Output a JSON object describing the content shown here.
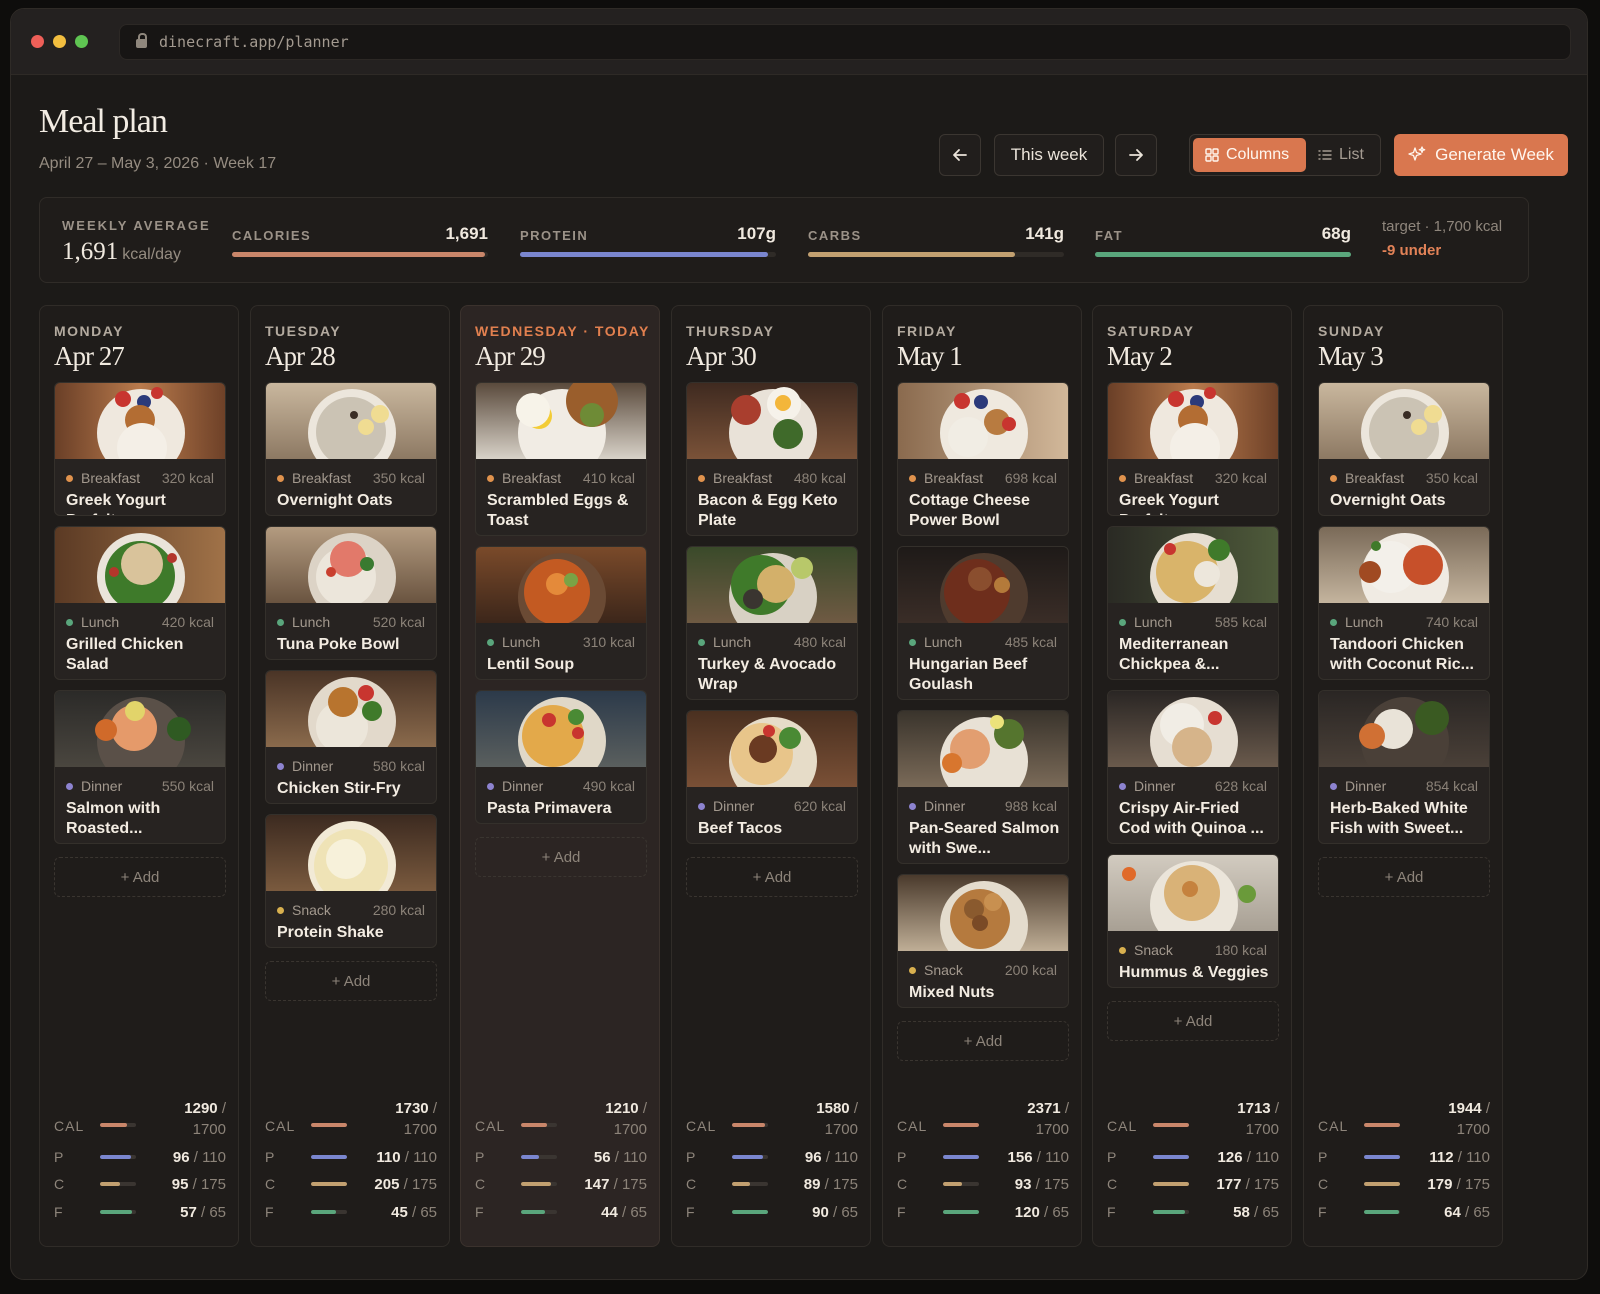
{
  "browser": {
    "url": "dinecraft.app/planner"
  },
  "header": {
    "title": "Meal plan",
    "subtitle": "April 27 – May 3, 2026 · Week 17",
    "prev_icon": "arrow-left-icon",
    "this_week_label": "This week",
    "next_icon": "arrow-right-icon",
    "view_columns_label": "Columns",
    "view_list_label": "List",
    "generate_label": "Generate Week"
  },
  "summary": {
    "label": "WEEKLY AVERAGE",
    "avg_value": "1,691",
    "avg_unit": "kcal/day",
    "macros": [
      {
        "label": "CALORIES",
        "value": "1,691",
        "progress": 0.99,
        "color": "#c9866a"
      },
      {
        "label": "PROTEIN",
        "value": "107g",
        "progress": 0.97,
        "color": "#7a86cf"
      },
      {
        "label": "CARBS",
        "value": "141g",
        "progress": 0.81,
        "color": "#c2a070"
      },
      {
        "label": "FAT",
        "value": "68g",
        "progress": 1.0,
        "color": "#5aa67c"
      }
    ],
    "target": "target · 1,700 kcal",
    "delta": "-9 under"
  },
  "meal_colors": {
    "Breakfast": "#e0924d",
    "Lunch": "#5aa67c",
    "Dinner": "#8d83d0",
    "Snack": "#d8b04f"
  },
  "bar_colors": {
    "cal": "#c9866a",
    "p": "#7a86cf",
    "c": "#c2a070",
    "f": "#5aa67c"
  },
  "add_label": "+ Add",
  "totals_labels": {
    "cal": "CAL",
    "p": "P",
    "c": "C",
    "f": "F"
  },
  "days": [
    {
      "name": "MONDAY",
      "date": "Apr 27",
      "meals": [
        {
          "type": "Breakfast",
          "kcal": "320 kcal",
          "name": "Greek Yogurt Parfait"
        },
        {
          "type": "Lunch",
          "kcal": "420 kcal",
          "name": "Grilled Chicken Salad"
        },
        {
          "type": "Dinner",
          "kcal": "550 kcal",
          "name": "Salmon with Roasted..."
        }
      ],
      "totals": {
        "cal": "1290",
        "cal_t": "1700",
        "p": "96",
        "p_t": "110",
        "c": "95",
        "c_t": "175",
        "f": "57",
        "f_t": "65"
      }
    },
    {
      "name": "TUESDAY",
      "date": "Apr 28",
      "meals": [
        {
          "type": "Breakfast",
          "kcal": "350 kcal",
          "name": "Overnight Oats"
        },
        {
          "type": "Lunch",
          "kcal": "520 kcal",
          "name": "Tuna Poke Bowl"
        },
        {
          "type": "Dinner",
          "kcal": "580 kcal",
          "name": "Chicken Stir-Fry"
        },
        {
          "type": "Snack",
          "kcal": "280 kcal",
          "name": "Protein Shake"
        }
      ],
      "totals": {
        "cal": "1730",
        "cal_t": "1700",
        "p": "110",
        "p_t": "110",
        "c": "205",
        "c_t": "175",
        "f": "45",
        "f_t": "65"
      }
    },
    {
      "name": "WEDNESDAY · TODAY",
      "date": "Apr 29",
      "today": true,
      "meals": [
        {
          "type": "Breakfast",
          "kcal": "410 kcal",
          "name": "Scrambled Eggs & Toast"
        },
        {
          "type": "Lunch",
          "kcal": "310 kcal",
          "name": "Lentil Soup"
        },
        {
          "type": "Dinner",
          "kcal": "490 kcal",
          "name": "Pasta Primavera"
        }
      ],
      "totals": {
        "cal": "1210",
        "cal_t": "1700",
        "p": "56",
        "p_t": "110",
        "c": "147",
        "c_t": "175",
        "f": "44",
        "f_t": "65"
      }
    },
    {
      "name": "THURSDAY",
      "date": "Apr 30",
      "meals": [
        {
          "type": "Breakfast",
          "kcal": "480 kcal",
          "name": "Bacon & Egg Keto Plate"
        },
        {
          "type": "Lunch",
          "kcal": "480 kcal",
          "name": "Turkey & Avocado Wrap"
        },
        {
          "type": "Dinner",
          "kcal": "620 kcal",
          "name": "Beef Tacos"
        }
      ],
      "totals": {
        "cal": "1580",
        "cal_t": "1700",
        "p": "96",
        "p_t": "110",
        "c": "89",
        "c_t": "175",
        "f": "90",
        "f_t": "65"
      }
    },
    {
      "name": "FRIDAY",
      "date": "May 1",
      "meals": [
        {
          "type": "Breakfast",
          "kcal": "698 kcal",
          "name": "Cottage Cheese Power Bowl"
        },
        {
          "type": "Lunch",
          "kcal": "485 kcal",
          "name": "Hungarian Beef Goulash"
        },
        {
          "type": "Dinner",
          "kcal": "988 kcal",
          "name": "Pan-Seared Salmon with Swe..."
        },
        {
          "type": "Snack",
          "kcal": "200 kcal",
          "name": "Mixed Nuts"
        }
      ],
      "totals": {
        "cal": "2371",
        "cal_t": "1700",
        "p": "156",
        "p_t": "110",
        "c": "93",
        "c_t": "175",
        "f": "120",
        "f_t": "65"
      }
    },
    {
      "name": "SATURDAY",
      "date": "May 2",
      "meals": [
        {
          "type": "Breakfast",
          "kcal": "320 kcal",
          "name": "Greek Yogurt Parfait"
        },
        {
          "type": "Lunch",
          "kcal": "585 kcal",
          "name": "Mediterranean Chickpea &..."
        },
        {
          "type": "Dinner",
          "kcal": "628 kcal",
          "name": "Crispy Air-Fried Cod with Quinoa ..."
        },
        {
          "type": "Snack",
          "kcal": "180 kcal",
          "name": "Hummus & Veggies"
        }
      ],
      "totals": {
        "cal": "1713",
        "cal_t": "1700",
        "p": "126",
        "p_t": "110",
        "c": "177",
        "c_t": "175",
        "f": "58",
        "f_t": "65"
      }
    },
    {
      "name": "SUNDAY",
      "date": "May 3",
      "meals": [
        {
          "type": "Breakfast",
          "kcal": "350 kcal",
          "name": "Overnight Oats"
        },
        {
          "type": "Lunch",
          "kcal": "740 kcal",
          "name": "Tandoori Chicken with Coconut Ric..."
        },
        {
          "type": "Dinner",
          "kcal": "854 kcal",
          "name": "Herb-Baked White Fish with Sweet..."
        }
      ],
      "totals": {
        "cal": "1944",
        "cal_t": "1700",
        "p": "112",
        "p_t": "110",
        "c": "179",
        "c_t": "175",
        "f": "64",
        "f_t": "65"
      }
    }
  ]
}
